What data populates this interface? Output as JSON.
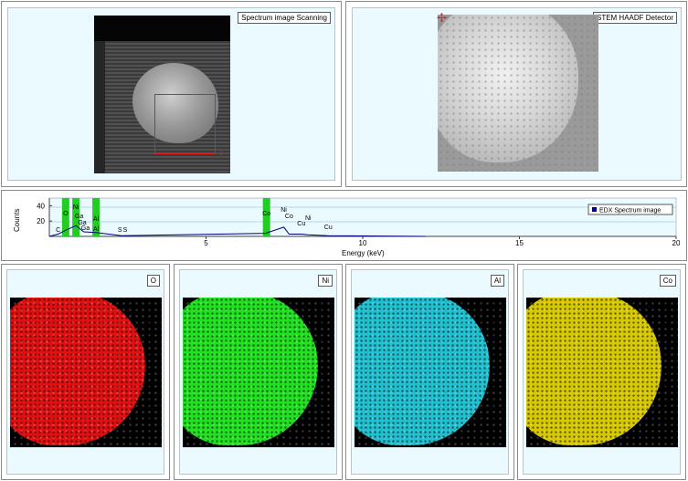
{
  "top_left": {
    "label": "Spectrum image Scanning",
    "roi_marker": "1"
  },
  "top_right": {
    "label": "STEM HAADF Detector"
  },
  "spectrum": {
    "y_label": "Counts",
    "x_label": "Energy (keV)",
    "legend": "EDX Spectrum image",
    "legend_color": "#000080",
    "highlight_color": "#22cc22"
  },
  "chart_data": {
    "type": "line",
    "title": "",
    "xlabel": "Energy (keV)",
    "ylabel": "Counts",
    "xlim": [
      0,
      20
    ],
    "ylim": [
      0,
      50
    ],
    "x_ticks": [
      "5",
      "10",
      "15",
      "20"
    ],
    "y_ticks": [
      "20",
      "40"
    ],
    "series": [
      {
        "name": "EDX Spectrum image",
        "x": [
          0.0,
          0.28,
          0.52,
          0.85,
          1.1,
          1.49,
          2.3,
          6.9,
          7.48,
          7.65,
          8.04,
          8.26,
          8.9,
          12.0
        ],
        "y": [
          0,
          3,
          8,
          14,
          6,
          5,
          1,
          4,
          12,
          3,
          3,
          2,
          1,
          0
        ]
      }
    ],
    "peak_labels": [
      {
        "text": "C",
        "x": 0.28
      },
      {
        "text": "O",
        "x": 0.52
      },
      {
        "text": "Ni",
        "x": 0.85
      },
      {
        "text": "Ga",
        "x": 0.95
      },
      {
        "text": "Ga",
        "x": 1.15
      },
      {
        "text": "Ga",
        "x": 1.05
      },
      {
        "text": "Al",
        "x": 1.49
      },
      {
        "text": "Al",
        "x": 1.49
      },
      {
        "text": "S",
        "x": 2.25
      },
      {
        "text": "S",
        "x": 2.42
      },
      {
        "text": "Co",
        "x": 6.93
      },
      {
        "text": "Ni",
        "x": 7.48
      },
      {
        "text": "Co",
        "x": 7.65
      },
      {
        "text": "Cu",
        "x": 8.04
      },
      {
        "text": "Ni",
        "x": 8.26
      },
      {
        "text": "Cu",
        "x": 8.9
      }
    ],
    "highlights": [
      0.52,
      0.85,
      1.49,
      6.93
    ]
  },
  "maps": [
    {
      "label": "O",
      "color": "#e01010"
    },
    {
      "label": "Ni",
      "color": "#20e020"
    },
    {
      "label": "Al",
      "color": "#20c0d0"
    },
    {
      "label": "Co",
      "color": "#d8c800"
    }
  ]
}
